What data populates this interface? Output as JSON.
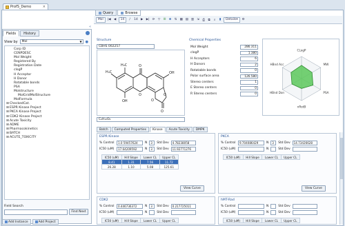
{
  "document_tab": {
    "label": "ProfS_Demo"
  },
  "right_tabs": [
    {
      "label": "Query"
    },
    {
      "label": "Browse"
    }
  ],
  "toolbar": {
    "record_label": "Mol",
    "record_current": "14",
    "record_separator": "/",
    "record_total": "14",
    "details_label": "Details"
  },
  "left_panel": {
    "tabs": [
      {
        "label": "Fields"
      },
      {
        "label": "History"
      }
    ],
    "view_by_label": "View by",
    "view_by_value": "Mol",
    "tree": [
      {
        "label": "Corp ID",
        "indent": 1,
        "exp": ""
      },
      {
        "label": "CENPDESC",
        "indent": 1,
        "exp": ""
      },
      {
        "label": "Mol Weight",
        "indent": 1,
        "exp": ""
      },
      {
        "label": "Registered By",
        "indent": 1,
        "exp": ""
      },
      {
        "label": "Registration Date",
        "indent": 1,
        "exp": ""
      },
      {
        "label": "clogP",
        "indent": 1,
        "exp": ""
      },
      {
        "label": "H Acceptor",
        "indent": 1,
        "exp": ""
      },
      {
        "label": "H Donor",
        "indent": 1,
        "exp": ""
      },
      {
        "label": "Rotatable bonds",
        "indent": 1,
        "exp": ""
      },
      {
        "label": "PSA",
        "indent": 1,
        "exp": ""
      },
      {
        "label": "Molstructure",
        "indent": 1,
        "exp": ""
      },
      {
        "label": "MolGridMolStructure",
        "indent": 2,
        "exp": ""
      },
      {
        "label": "MolFormula",
        "indent": 1,
        "exp": ""
      },
      {
        "label": "CheckedCat.",
        "indent": 0,
        "exp": "+"
      },
      {
        "label": "ESPR Kinase Project",
        "indent": 0,
        "exp": "+"
      },
      {
        "label": "PKCA Kinase Project",
        "indent": 0,
        "exp": "+"
      },
      {
        "label": "CDK2 Kinase Project",
        "indent": 0,
        "exp": "+"
      },
      {
        "label": "Acute Toxicity",
        "indent": 0,
        "exp": "+"
      },
      {
        "label": "ADME",
        "indent": 0,
        "exp": "+"
      },
      {
        "label": "Pharmacokinetics",
        "indent": 0,
        "exp": "+"
      },
      {
        "label": "BATCH",
        "indent": 0,
        "exp": "+"
      },
      {
        "label": "ACUTE_TOXICITY",
        "indent": 0,
        "exp": "+"
      }
    ],
    "field_search_label": "Field Search",
    "find_next_label": "Find Next"
  },
  "bottom_tabs": [
    {
      "label": "Add Instance"
    },
    {
      "label": "Add Project"
    }
  ],
  "structure": {
    "title": "Structure",
    "id_value": "CBHS 002257",
    "formula_value": "C₆H₁₀O₆"
  },
  "chemical_properties": {
    "title": "Chemical Properties",
    "rows": [
      {
        "label": "Mol Weight",
        "value": "286.311"
      },
      {
        "label": "clogP",
        "value": "1.380"
      },
      {
        "label": "H Acceptors",
        "value": "6"
      },
      {
        "label": "H Donors",
        "value": "2"
      },
      {
        "label": "Rotatable bonds",
        "value": "0"
      },
      {
        "label": "Polar surface area",
        "value": "126.580"
      },
      {
        "label": "Stereo centers",
        "value": "1"
      },
      {
        "label": "E Stereo centers",
        "value": "0"
      },
      {
        "label": "R Stereo centers",
        "value": "0"
      }
    ]
  },
  "radar": {
    "axes": [
      "CLogP",
      "MW",
      "PSA",
      "nRotB",
      "HBnd Don",
      "HBnd Acc"
    ],
    "values": [
      0.6,
      0.55,
      0.6,
      0.45,
      0.5,
      0.55
    ],
    "fill_color": "#5cc85c",
    "line_color": "#2d8a2d"
  },
  "assay_tabs": [
    {
      "label": "Batch"
    },
    {
      "label": "Computed Properties"
    },
    {
      "label": "Kinase"
    },
    {
      "label": "Acute Toxicity"
    },
    {
      "label": "DMPK"
    }
  ],
  "assays": {
    "espr": {
      "title": "ESPR Kinase",
      "row1": {
        "label": "% Control",
        "value": "1.0 59457624",
        "n_label": "N",
        "n_value": "3",
        "sd_label": "Std Dev",
        "sd_value": "4.78238058"
      },
      "row2": {
        "label": "IC50 (uM)",
        "value": "17.64209592",
        "n_label": "N",
        "n_value": "3",
        "sd_label": "Std Dev",
        "sd_value": "11.92771276"
      },
      "headers": [
        "IC50 (uM)",
        "Hill Slope",
        "Lower CL",
        "Upper CL"
      ],
      "rows": [
        [
          "8.41",
          "1.31",
          "7.56",
          "11.72"
        ],
        [
          "26.28",
          "1.10",
          "5.08",
          "125.61"
        ]
      ],
      "view_curve": "View Curve"
    },
    "pkca": {
      "title": "PKCA",
      "row1": {
        "label": "% Control",
        "value": "9.704086429",
        "n_label": "N",
        "n_value": "3",
        "sd_label": "Std Dev",
        "sd_value": "14.73426628"
      },
      "row2": {
        "label": "IC50 (uM)",
        "value": "",
        "n_label": "N",
        "n_value": "",
        "sd_label": "Std Dev",
        "sd_value": ""
      },
      "headers": [
        "IC50 (uM)",
        "Hill Slope",
        "Lower CL",
        "Upper CL"
      ],
      "view_curve": "View Curve"
    },
    "cdk2": {
      "title": "CDK2",
      "row1": {
        "label": "% Control",
        "value": "0.446736372",
        "n_label": "N",
        "n_value": "3",
        "sd_label": "Std Dev",
        "sd_value": "0.217725011"
      },
      "row2": {
        "label": "IC50 (uM)",
        "value": "",
        "n_label": "N",
        "n_value": "",
        "sd_label": "Std Dev",
        "sd_value": ""
      },
      "headers": [
        "IC50 (uM)",
        "Hill Slope",
        "Lower CL",
        "Upper CL"
      ]
    },
    "hmt": {
      "title": "hMT-Rad",
      "row1": {
        "label": "% Control",
        "value": "",
        "n_label": "N",
        "n_value": "",
        "sd_label": "Std Dev",
        "sd_value": ""
      },
      "row2": {
        "label": "IC50 (uM)",
        "value": "",
        "n_label": "N",
        "n_value": "",
        "sd_label": "Std Dev",
        "sd_value": ""
      },
      "headers": [
        "IC50 (uM)",
        "Hill Slope",
        "Lower CL",
        "Upper CL"
      ]
    }
  }
}
